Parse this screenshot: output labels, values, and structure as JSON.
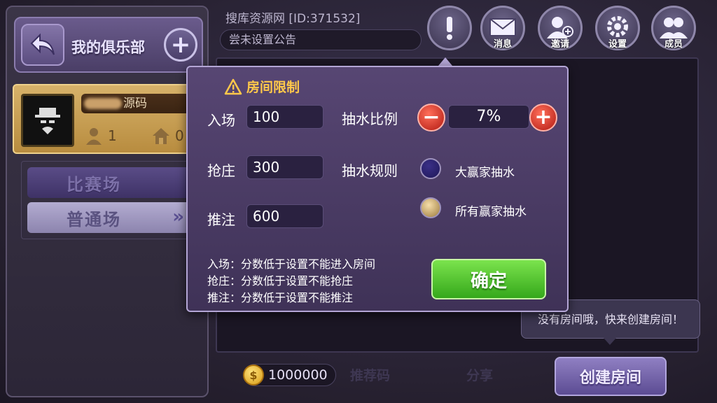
{
  "colors": {
    "accent_gold": "#ffc84a",
    "confirm_green": "#4cc42a",
    "stepper_red": "#d2281d",
    "panel_purple": "#574673"
  },
  "club": {
    "title": "我的俱乐部",
    "user_name": "源码",
    "members_count": "1",
    "rooms_count": "0",
    "modes": [
      "比赛场",
      "普通场"
    ]
  },
  "topbar": {
    "room_id": "搜库资源网 [ID:371532]",
    "notice": "尝未设置公告",
    "icons": [
      {
        "name": "alert-icon",
        "label": ""
      },
      {
        "name": "mail-icon",
        "label": "消息"
      },
      {
        "name": "invite-icon",
        "label": "邀请"
      },
      {
        "name": "settings-icon",
        "label": "设置"
      },
      {
        "name": "members-icon",
        "label": "成员"
      }
    ]
  },
  "dialog": {
    "title": "房间限制",
    "entry_label": "入场",
    "entry_value": "100",
    "banker_label": "抢庄",
    "banker_value": "300",
    "bet_label": "推注",
    "bet_value": "600",
    "ratio_label": "抽水比例",
    "ratio_value": "7%",
    "rule_label": "抽水规则",
    "rule_options": [
      "大赢家抽水",
      "所有赢家抽水"
    ],
    "rule_selected": "所有赢家抽水",
    "notes": [
      "入场：分数低于设置不能进入房间",
      "抢庄：分数低于设置不能抢庄",
      "推注：分数低于设置不能推注"
    ],
    "confirm_label": "确定"
  },
  "bottom": {
    "coins": "1000000",
    "recommend_code": "推荐码",
    "share": "分享",
    "create_room": "创建房间",
    "tooltip": "没有房间哦，快来创建房间！"
  }
}
